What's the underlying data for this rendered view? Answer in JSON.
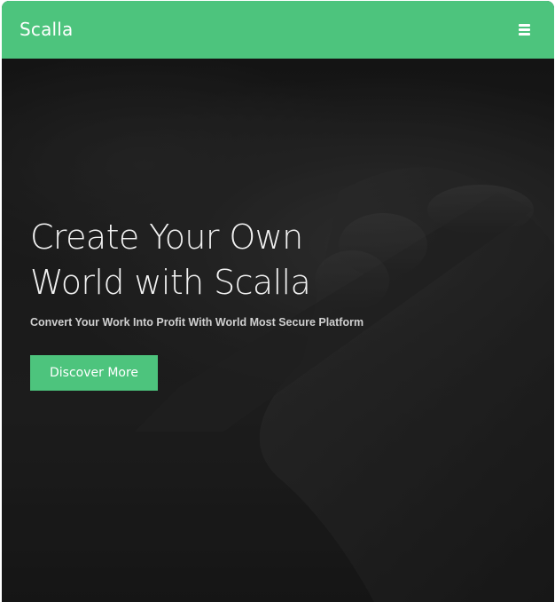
{
  "header": {
    "brand": "Scalla",
    "menu_icon": "hamburger-menu-icon"
  },
  "hero": {
    "title": "Create Your Own World with Scalla",
    "subtitle": "Convert Your Work Into Profit With World Most Secure Platform",
    "cta_label": "Discover More",
    "background": "dark photo of hand on keyboard"
  },
  "colors": {
    "accent": "#4dc47d",
    "hero_dark": "#202020",
    "text_light": "#f2f2f2"
  }
}
